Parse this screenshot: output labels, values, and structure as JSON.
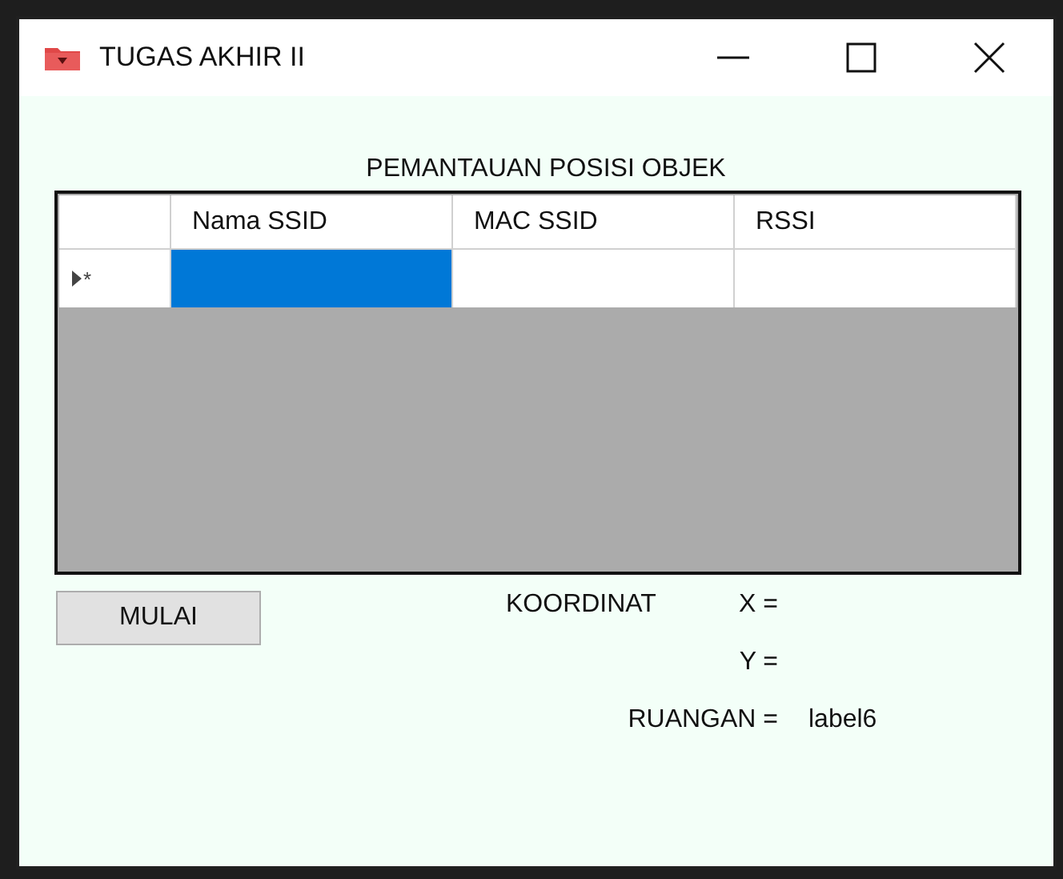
{
  "window": {
    "title": "TUGAS AKHIR II"
  },
  "heading": "PEMANTAUAN POSISI OBJEK",
  "table": {
    "columns": [
      "Nama SSID",
      "MAC SSID",
      "RSSI"
    ],
    "rows": [
      {
        "marker": "*",
        "current": true,
        "cells": [
          {
            "selected": true
          },
          {
            "selected": false
          },
          {
            "selected": false
          }
        ]
      }
    ]
  },
  "start_button": "MULAI",
  "labels": {
    "coordinate": "KOORDINAT",
    "x": "X =",
    "y": "Y =",
    "room": "RUANGAN =",
    "room_value": "label6"
  }
}
